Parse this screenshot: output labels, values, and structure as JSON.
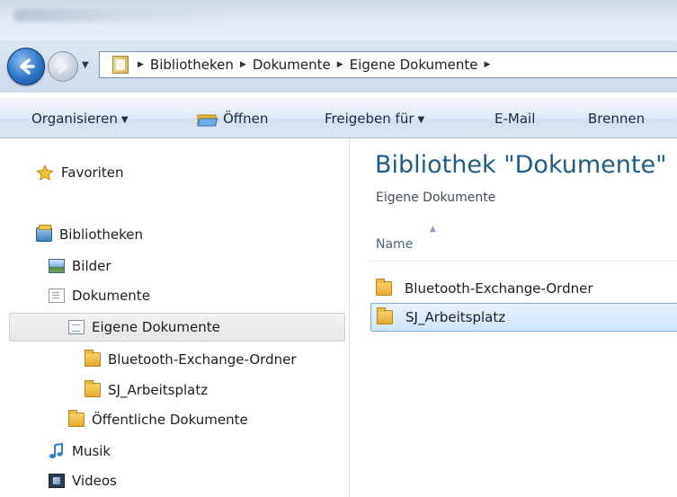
{
  "address": {
    "crumbs": [
      "Bibliotheken",
      "Dokumente",
      "Eigene Dokumente"
    ],
    "icons": {
      "back": "back-arrow-icon",
      "forward": "forward-arrow-icon",
      "folder": "library-folder-icon"
    }
  },
  "toolbar": {
    "organize": "Organisieren",
    "open": "Öffnen",
    "share": "Freigeben für",
    "email": "E-Mail",
    "burn": "Brennen"
  },
  "navpane": {
    "favorites": "Favoriten",
    "libraries": "Bibliotheken",
    "items": [
      {
        "label": "Bilder",
        "icon": "pictures-icon"
      },
      {
        "label": "Dokumente",
        "icon": "documents-icon"
      },
      {
        "label": "Eigene Dokumente",
        "icon": "document-folder-icon",
        "selected": true
      },
      {
        "label": "Bluetooth-Exchange-Ordner",
        "icon": "folder-icon"
      },
      {
        "label": "SJ_Arbeitsplatz",
        "icon": "folder-icon"
      },
      {
        "label": "Öffentliche Dokumente",
        "icon": "folder-icon"
      },
      {
        "label": "Musik",
        "icon": "music-icon"
      },
      {
        "label": "Videos",
        "icon": "videos-icon"
      }
    ]
  },
  "content": {
    "title": "Bibliothek \"Dokumente\"",
    "subtitle": "Eigene Dokumente",
    "column_name": "Name",
    "files": [
      {
        "name": "Bluetooth-Exchange-Ordner",
        "selected": false
      },
      {
        "name": "SJ_Arbeitsplatz",
        "selected": true
      }
    ]
  },
  "colors": {
    "title_blue": "#1f5c86",
    "selection_blue": "#cde4f9",
    "toolbar_text": "#1b2d45"
  }
}
